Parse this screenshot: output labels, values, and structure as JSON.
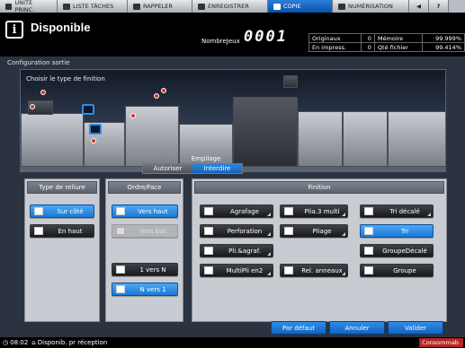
{
  "tabs": [
    {
      "label": "UNITE PRINC.",
      "icon": "home-icon"
    },
    {
      "label": "LISTE TÂCHES",
      "icon": "job-list-icon"
    },
    {
      "label": "RAPPELER",
      "icon": "recall-icon"
    },
    {
      "label": "ENREGISTRER",
      "icon": "store-icon"
    },
    {
      "label": "COPIE",
      "icon": "copy-icon",
      "active": true
    },
    {
      "label": "NUMÉRISATION",
      "icon": "scan-icon"
    }
  ],
  "header": {
    "status": "Disponible",
    "info_glyph": "i",
    "nombre_label": "NombreJeux",
    "counter": "0001",
    "stats": [
      {
        "label": "Originaux",
        "value": "0",
        "label2": "Mémoire",
        "value2": "99.999%"
      },
      {
        "label": "En impress.",
        "value": "0",
        "label2": "Qté fichier",
        "value2": "99.414%"
      }
    ]
  },
  "panel": {
    "title": "Configuration sortie",
    "scene_label": "Choisir le type de finition",
    "empilage": {
      "label": "Empilage",
      "options": [
        "Autoriser",
        "Interdire"
      ],
      "selected": "Interdire"
    }
  },
  "reliure": {
    "title": "Type de reliure",
    "buttons": [
      {
        "label": "Sur côté",
        "selected": true
      },
      {
        "label": "En haut",
        "selected": false
      }
    ]
  },
  "ordre": {
    "title": "Ordre/Face",
    "buttons": [
      {
        "label": "Vers haut",
        "selected": true
      },
      {
        "label": "Vers bas",
        "disabled": true
      },
      {
        "label": "1 vers N",
        "selected": false
      },
      {
        "label": "N vers 1",
        "selected": true
      }
    ]
  },
  "finition": {
    "title": "Finition",
    "col1": [
      "Agrafage",
      "Perforation",
      "Pli.&agraf.",
      "MultiPli en2"
    ],
    "col2": [
      "Plia.3 multi",
      "Pliage",
      "Rel. anneaux"
    ],
    "col3": [
      "Tri décalé",
      "Tri",
      "GroupeDécalé",
      "Groupe"
    ],
    "selected": "Tri"
  },
  "footer": {
    "buttons": [
      "Par défaut",
      "Annuler",
      "Valider"
    ]
  },
  "bottom": {
    "time": "08:02",
    "status": "Disponib. pr réception",
    "consumables": "Consommab."
  },
  "colors": {
    "accent": "#1e7ad8",
    "panel": "#2c3340",
    "selected_btn": "#3a9cf0"
  }
}
